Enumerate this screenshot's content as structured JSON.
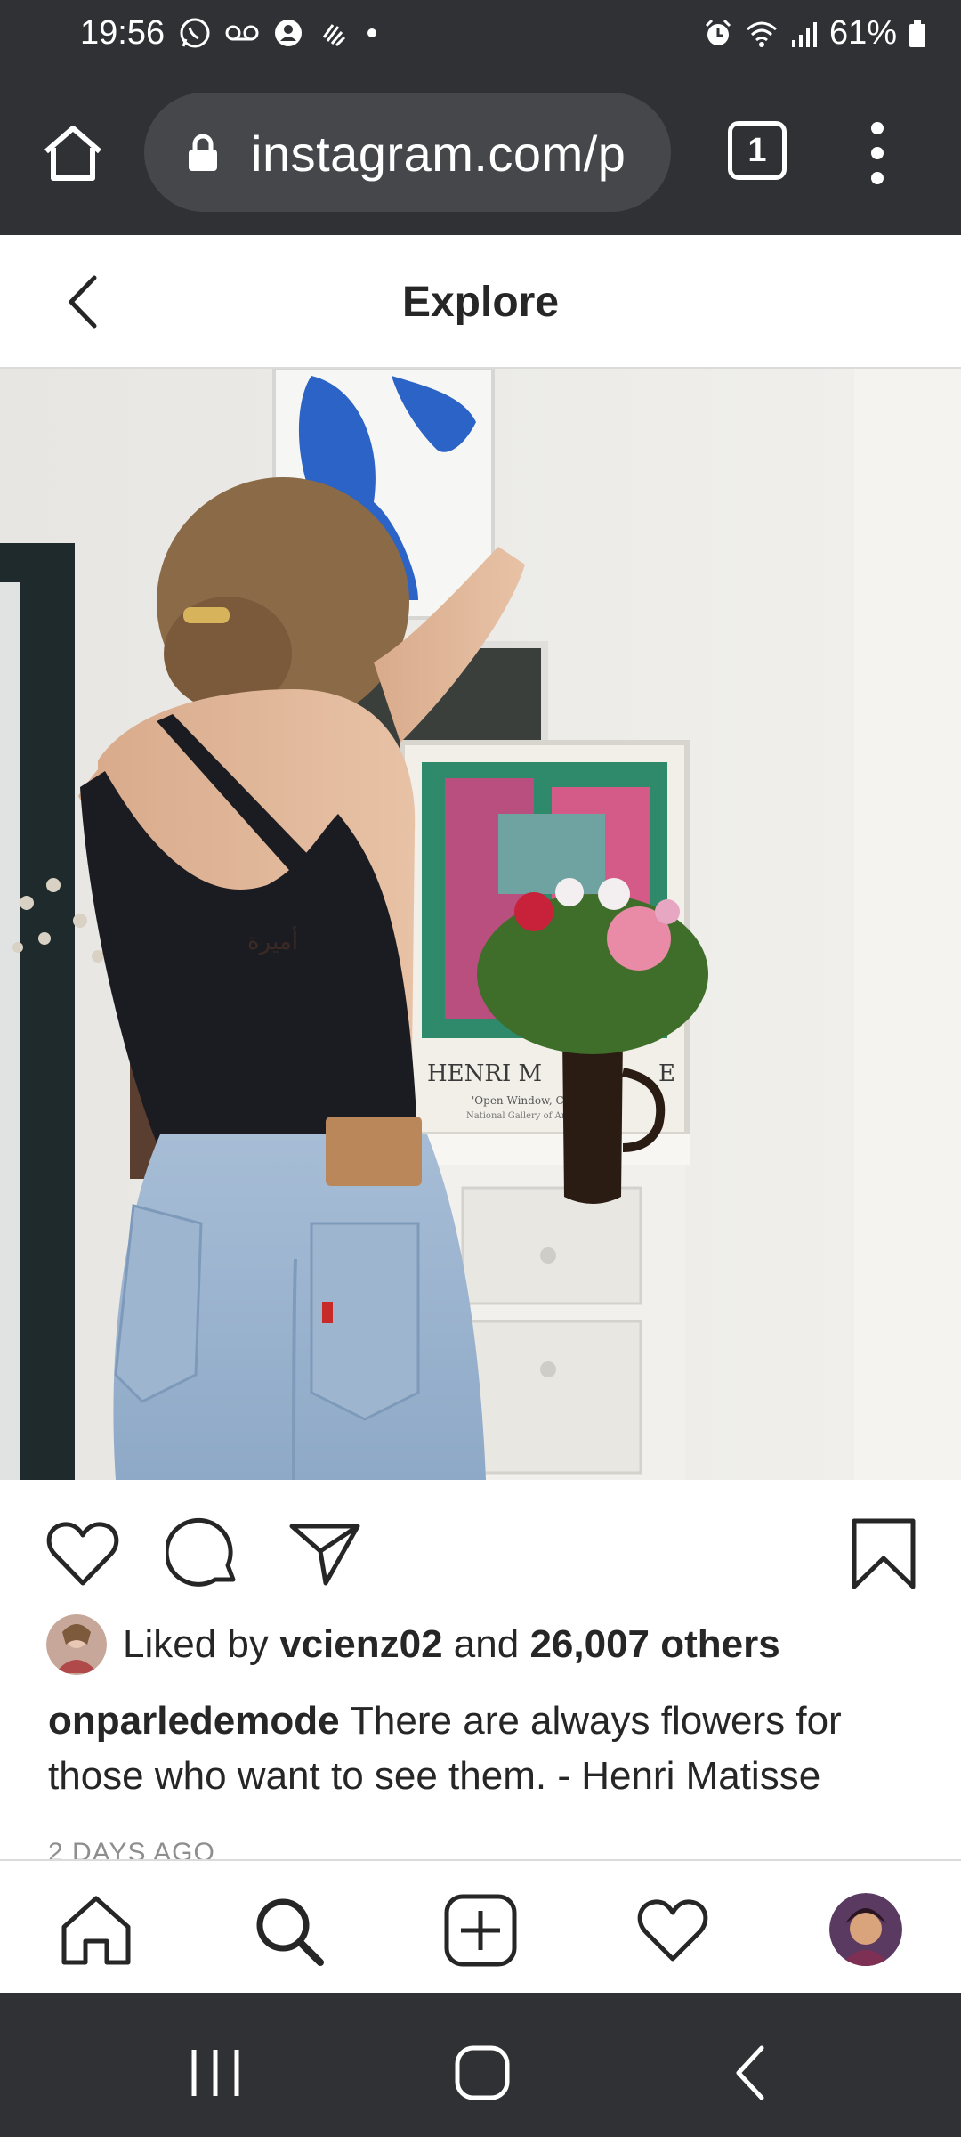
{
  "status_bar": {
    "time": "19:56",
    "battery": "61%",
    "left_icons": [
      "whatsapp-icon",
      "voicemail-icon",
      "account-icon",
      "hand-icon",
      "dot-icon"
    ],
    "right_icons": [
      "alarm-icon",
      "wifi-icon",
      "signal-icon",
      "battery-icon"
    ]
  },
  "browser": {
    "url": "instagram.com/p",
    "tab_count": "1"
  },
  "header": {
    "title": "Explore"
  },
  "post": {
    "photo_text": {
      "poster_line1": "HENRI M",
      "poster_line1_end": "E",
      "poster_line2": "'Open Window, C",
      "poster_line3": "National Gallery of Art,",
      "tattoo": "أميرة"
    },
    "likes": {
      "prefix": "Liked by ",
      "user": "vcienz02",
      "middle": " and ",
      "count": "26,007 others"
    },
    "caption": {
      "username": "onparledemode",
      "text": " There are always flowers for those who want to see them. - Henri Matisse"
    },
    "time_ago": "2 DAYS AGO"
  },
  "colors": {
    "system_bar": "#303134",
    "url_pill": "#45474b",
    "text": "#262626",
    "muted": "#8e8e8e",
    "divider": "#dbdbdb"
  }
}
